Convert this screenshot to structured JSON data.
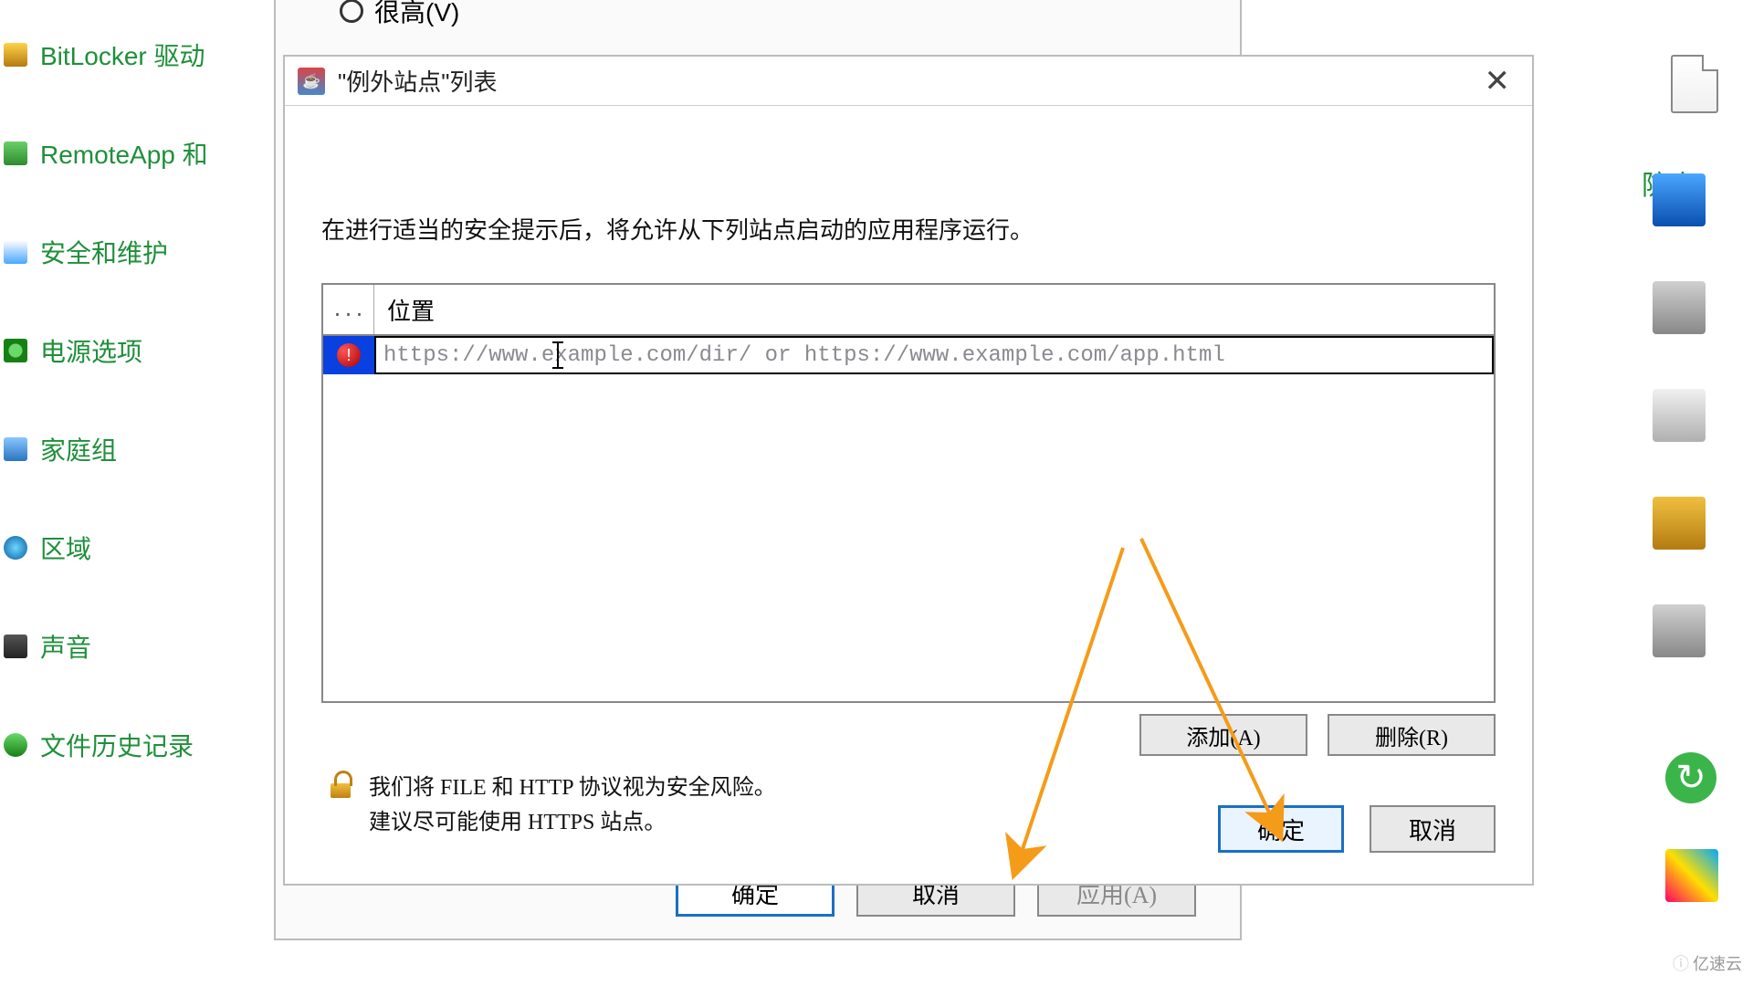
{
  "cp_items": [
    {
      "label": "BitLocker 驱动"
    },
    {
      "label": "RemoteApp 和"
    },
    {
      "label": "安全和维护"
    },
    {
      "label": "电源选项"
    },
    {
      "label": "家庭组"
    },
    {
      "label": "区域"
    },
    {
      "label": "声音"
    },
    {
      "label": "文件历史记录"
    }
  ],
  "cp_right_label": "防火",
  "parent": {
    "radio_vh": "很高(V)",
    "ok": "确定",
    "cancel": "取消",
    "apply": "应用(A)"
  },
  "dialog": {
    "title": "\"例外站点\"列表",
    "description": "在进行适当的安全提示后，将允许从下列站点启动的应用程序运行。",
    "col_dots": "...",
    "col_location": "位置",
    "url_placeholder": "https://www.example.com/dir/ or https://www.example.com/app.html",
    "url_value": "",
    "add_btn": "添加(A)",
    "remove_btn": "删除(R)",
    "warn_line1": "我们将 FILE 和 HTTP 协议视为安全风险。",
    "warn_line2": "建议尽可能使用 HTTPS 站点。",
    "ok": "确定",
    "cancel": "取消"
  },
  "watermark": "亿速云",
  "colors": {
    "link": "#1f8f3a",
    "primary_border": "#1a6fc4",
    "arrow": "#f59b1a"
  }
}
